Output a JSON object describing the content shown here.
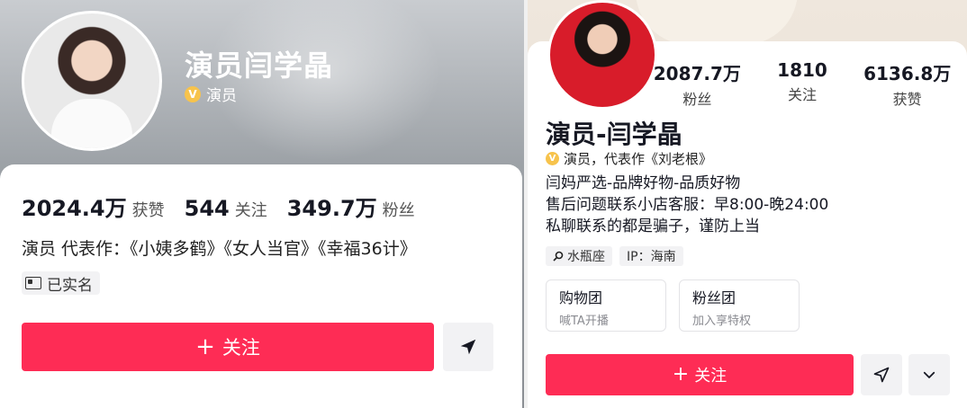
{
  "left": {
    "name": "演员闫学晶",
    "verified_label": "演员",
    "verified_mark": "V",
    "stats": [
      {
        "num": "2024.4万",
        "label": "获赞"
      },
      {
        "num": "544",
        "label": "关注"
      },
      {
        "num": "349.7万",
        "label": "粉丝"
      }
    ],
    "bio": "演员 代表作：《小姨多鹤》《女人当官》《幸福36计》",
    "realname_label": "已实名",
    "follow_label": "关注",
    "follow_plus": "+"
  },
  "right": {
    "name": "演员-闫学晶",
    "verified_text": "演员，代表作《刘老根》",
    "verified_mark": "V",
    "stats": [
      {
        "num": "2087.7万",
        "label": "粉丝"
      },
      {
        "num": "1810",
        "label": "关注"
      },
      {
        "num": "6136.8万",
        "label": "获赞"
      }
    ],
    "bio_lines": [
      "闫妈严选-品牌好物-品质好物",
      "售后问题联系小店客服：早8:00-晚24:00",
      "私聊联系的都是骗子，谨防上当"
    ],
    "tags": [
      {
        "icon": "search-icon",
        "text": "水瓶座"
      },
      {
        "icon": "",
        "text": "IP：海南"
      }
    ],
    "boxes": [
      {
        "title": "购物团",
        "sub": "喊TA开播"
      },
      {
        "title": "粉丝团",
        "sub": "加入享特权"
      }
    ],
    "follow_label": "关注",
    "follow_plus": "+"
  },
  "colors": {
    "accent": "#fe2c55",
    "verified": "#f7c34c"
  }
}
